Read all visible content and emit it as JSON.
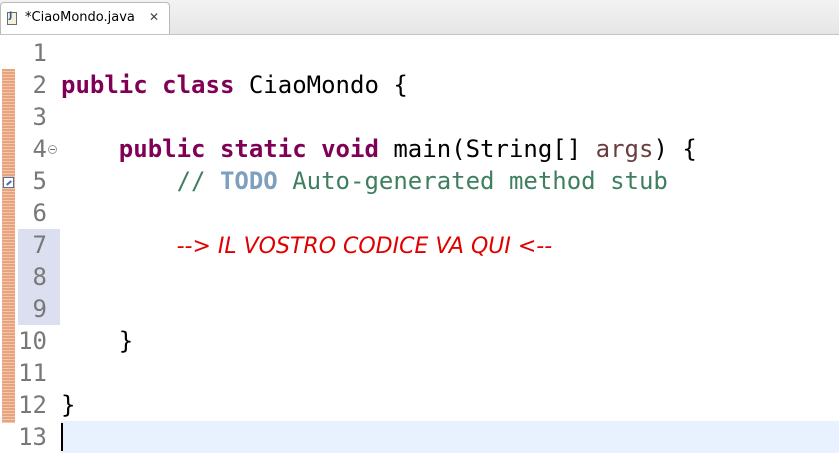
{
  "tab": {
    "title": "*CiaoMondo.java",
    "close_glyph": "✕",
    "icon": "java-file-icon"
  },
  "editor": {
    "line_numbers": [
      "1",
      "2",
      "3",
      "4",
      "5",
      "6",
      "7",
      "8",
      "9",
      "10",
      "11",
      "12",
      "13"
    ],
    "highlighted_lines": [
      7,
      8,
      9
    ],
    "current_line": 13,
    "code": {
      "l2_kw1": "public",
      "l2_kw2": "class",
      "l2_name": "CiaoMondo",
      "l2_brace": "{",
      "l4_kw1": "public",
      "l4_kw2": "static",
      "l4_kw3": "void",
      "l4_sig": "main(String[]",
      "l4_param": "args",
      "l4_end": ") {",
      "l5_slashes": "// ",
      "l5_todo": "TODO",
      "l5_rest": " Auto-generated method stub",
      "l7_note": "--> IL VOSTRO CODICE VA QUI <--",
      "l10_brace": "}",
      "l12_brace": "}"
    },
    "colors": {
      "keyword": "#7f0055",
      "comment": "#3f7f5f",
      "todo": "#7f9fbf",
      "note": "#e00000",
      "current_line_bg": "#e8f2fe"
    }
  }
}
